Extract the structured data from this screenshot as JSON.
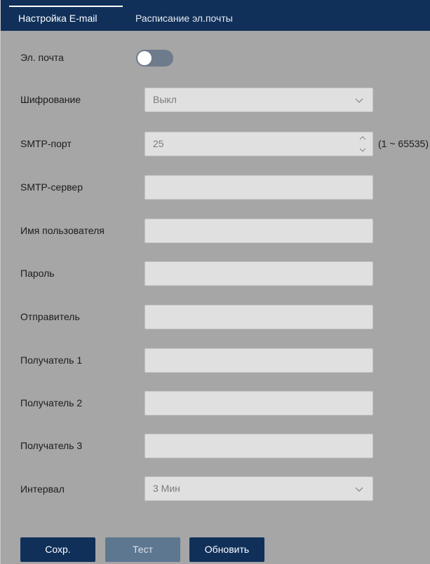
{
  "tabs": [
    {
      "label": "Настройка E-mail",
      "active": true
    },
    {
      "label": "Расписание эл.почты",
      "active": false
    }
  ],
  "form": {
    "email": {
      "label": "Эл. почта",
      "enabled": false
    },
    "encryption": {
      "label": "Шифрование",
      "value": "Выкл"
    },
    "smtp_port": {
      "label": "SMTP-порт",
      "value": "25",
      "range": "(1 ~ 65535)"
    },
    "smtp_server": {
      "label": "SMTP-сервер",
      "value": ""
    },
    "username": {
      "label": "Имя пользователя",
      "value": ""
    },
    "password": {
      "label": "Пароль",
      "value": ""
    },
    "sender": {
      "label": "Отправитель",
      "value": ""
    },
    "recipient1": {
      "label": "Получатель 1",
      "value": ""
    },
    "recipient2": {
      "label": "Получатель 2",
      "value": ""
    },
    "recipient3": {
      "label": "Получатель 3",
      "value": ""
    },
    "interval": {
      "label": "Интервал",
      "value": "3 Мин"
    }
  },
  "buttons": {
    "save": "Сохр.",
    "test": "Тест",
    "refresh": "Обновить"
  },
  "colors": {
    "header": "#10305a",
    "background": "#a6a6a6",
    "field": "#e0e0e0",
    "button_primary": "#10305a",
    "button_disabled": "#5e7790"
  },
  "icons": {
    "select": "chevron-down-icon",
    "spinner": "spinner-arrows-icon"
  }
}
